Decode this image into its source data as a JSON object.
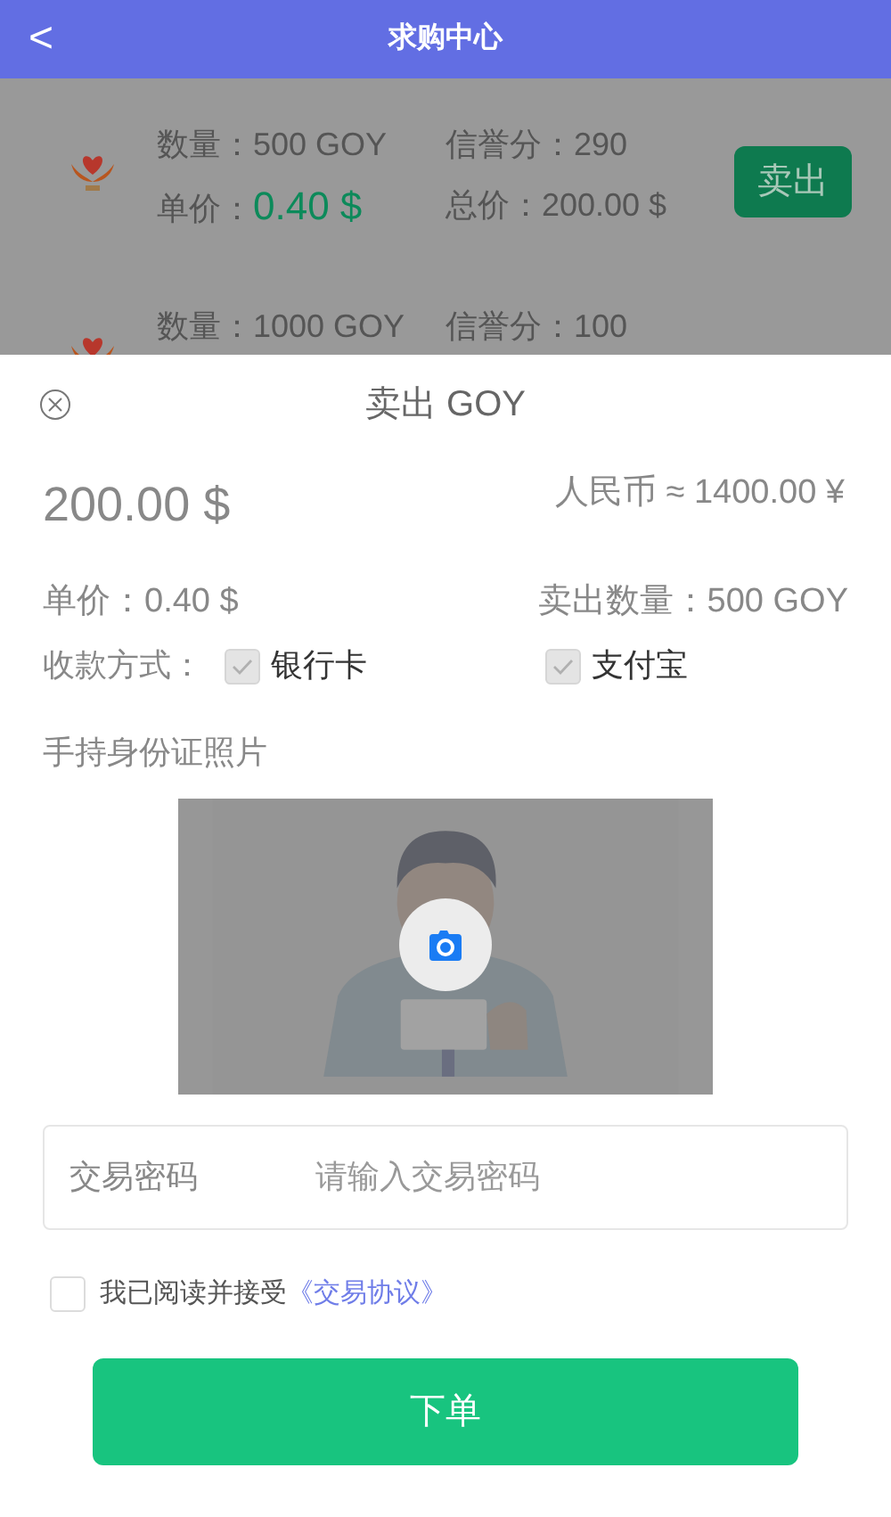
{
  "header": {
    "back_icon": "<",
    "title": "求购中心"
  },
  "listings": [
    {
      "quantity": "数量：500 GOY",
      "credit": "信誉分：290",
      "price_label": "单价：",
      "price": "0.40 $",
      "total": "总价：200.00 $",
      "button": "卖出"
    },
    {
      "quantity": "数量：1000 GOY",
      "credit": "信誉分：100"
    }
  ],
  "sheet": {
    "title": "卖出 GOY",
    "amount": "200.00 $",
    "cny": "人民币 ≈ 1400.00 ¥",
    "unit_price": "单价：0.40 $",
    "sell_quantity": "卖出数量：500 GOY",
    "payment_label": "收款方式：",
    "payment_methods": [
      {
        "label": "银行卡",
        "checked": true,
        "disabled": true
      },
      {
        "label": "支付宝",
        "checked": true,
        "disabled": true
      }
    ],
    "photo_label": "手持身份证照片",
    "password": {
      "label": "交易密码",
      "placeholder": "请输入交易密码"
    },
    "agreement": {
      "checked": false,
      "text": "我已阅读并接受",
      "link": "《交易协议》"
    },
    "submit": "下单"
  }
}
